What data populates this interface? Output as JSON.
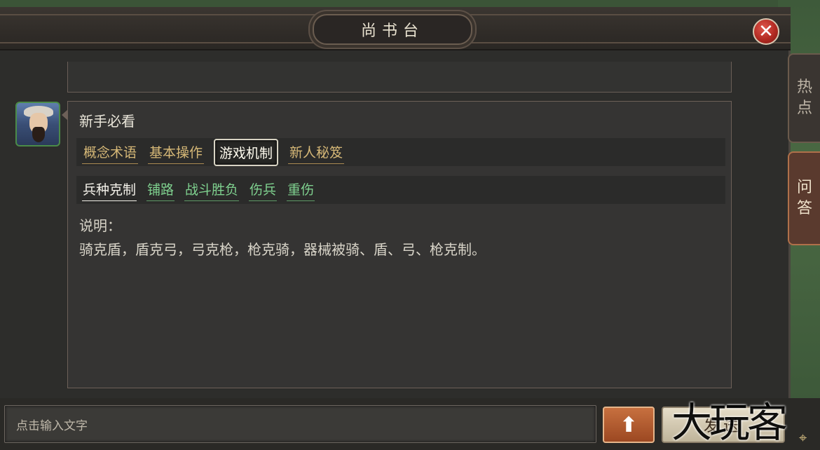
{
  "window": {
    "title": "尚书台",
    "close_glyph": "✕"
  },
  "side_tabs": [
    {
      "label_1": "热",
      "label_2": "点"
    },
    {
      "label_1": "问",
      "label_2": "答"
    }
  ],
  "chat": {
    "heading": "新手必看",
    "categories": [
      "概念术语",
      "基本操作",
      "游戏机制",
      "新人秘笈"
    ],
    "selected_category": "游戏机制",
    "subtopics": [
      "兵种克制",
      "铺路",
      "战斗胜负",
      "伤兵",
      "重伤"
    ],
    "selected_subtopic": "兵种克制",
    "description_label": "说明：",
    "description_text": "骑克盾，盾克弓，弓克枪，枪克骑，器械被骑、盾、弓、枪克制。"
  },
  "input": {
    "placeholder": "点击输入文字"
  },
  "buttons": {
    "scroll_up_glyph": "⬆",
    "send_label": "发送"
  },
  "watermark": "大玩客",
  "colors": {
    "category_gold": "#d6b877",
    "subtopic_green": "#7fd18f",
    "close_red": "#b22a22",
    "accent_orange": "#c7703f"
  },
  "icons": {
    "close": "close-icon",
    "arrow_up": "arrow-up-icon",
    "map_pin": "map-pin-icon"
  }
}
